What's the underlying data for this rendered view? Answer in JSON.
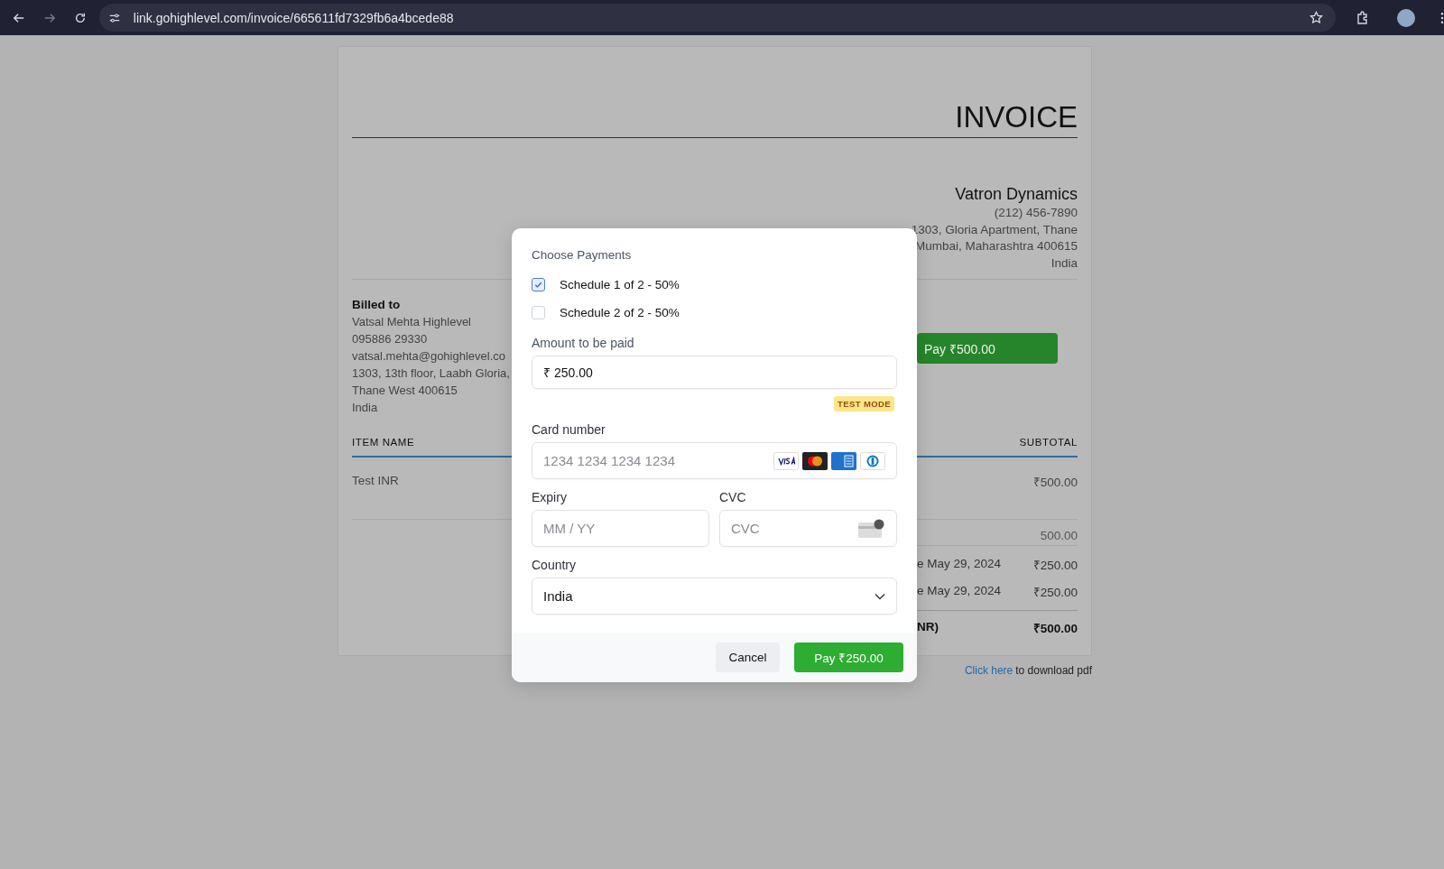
{
  "browser": {
    "url": "link.gohighlevel.com/invoice/665611fd7329fb6a4bcede88"
  },
  "invoice": {
    "title": "INVOICE",
    "company": {
      "name": "Vatron Dynamics",
      "lines": [
        "(212) 456-7890",
        "1303, Gloria Apartment, Thane",
        "Mumbai, Maharashtra 400615",
        "India"
      ]
    },
    "billed_to": {
      "heading": "Billed to",
      "lines": [
        "Vatsal Mehta Highlevel",
        "095886 29330",
        "vatsal.mehta@gohighlevel.co",
        "1303, 13th floor, Laabh Gloria,",
        "Thane West 400615",
        "India"
      ]
    },
    "pay_button": "Pay ₹500.00",
    "table": {
      "columns": [
        "ITEM NAME",
        "SUBTOTAL"
      ],
      "rows": [
        {
          "item": "Test INR",
          "subtotal": "₹500.00"
        }
      ]
    },
    "summary": [
      {
        "kind": "plain",
        "value": "500.00"
      },
      {
        "kind": "due",
        "label": "e May 29, 2024",
        "value": "₹250.00"
      },
      {
        "kind": "due",
        "label": "e May 29, 2024",
        "value": "₹250.00"
      },
      {
        "kind": "total",
        "label": "NR)",
        "value": "₹500.00"
      }
    ],
    "download": {
      "link": "Click here",
      "text": "to download pdf"
    }
  },
  "modal": {
    "heading": "Choose Payments",
    "schedules": [
      {
        "label": "Schedule 1 of 2 - 50%",
        "checked": true
      },
      {
        "label": "Schedule 2 of 2 - 50%",
        "checked": false
      }
    ],
    "amount": {
      "label": "Amount to be paid",
      "value": "₹ 250.00"
    },
    "badge": "TEST MODE",
    "card_number": {
      "label": "Card number",
      "placeholder": "1234 1234 1234 1234"
    },
    "expiry": {
      "label": "Expiry",
      "placeholder": "MM / YY"
    },
    "cvc": {
      "label": "CVC",
      "placeholder": "CVC"
    },
    "country": {
      "label": "Country",
      "value": "India"
    },
    "buttons": {
      "cancel": "Cancel",
      "pay": "Pay ₹250.00"
    }
  }
}
